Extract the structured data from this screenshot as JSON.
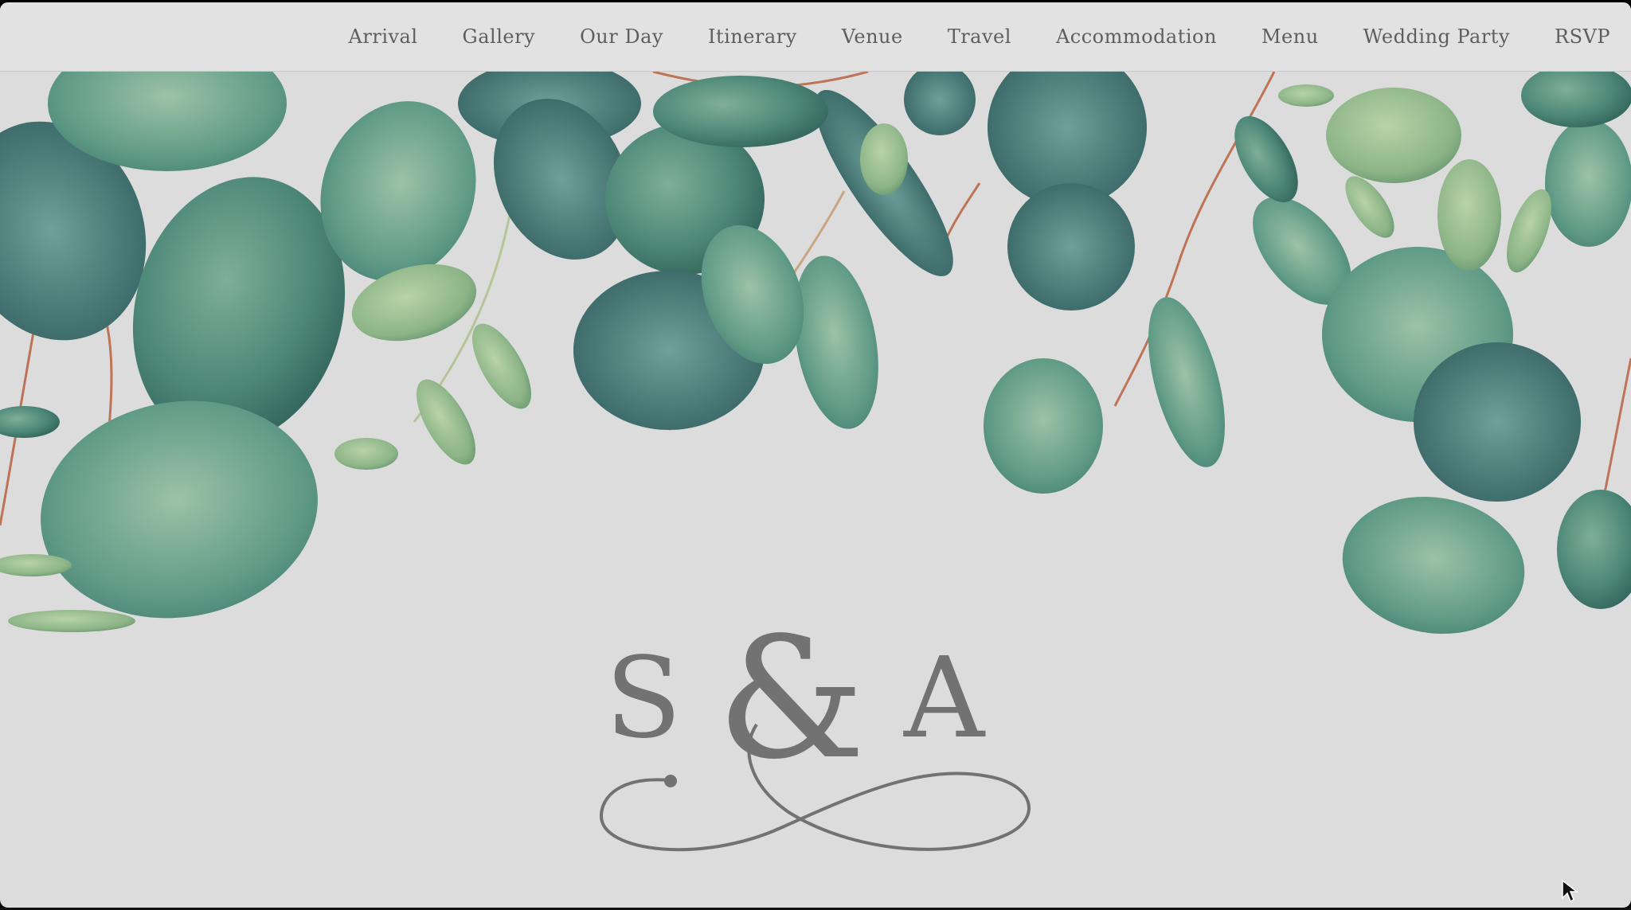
{
  "nav": {
    "items": [
      {
        "label": "Arrival"
      },
      {
        "label": "Gallery"
      },
      {
        "label": "Our Day"
      },
      {
        "label": "Itinerary"
      },
      {
        "label": "Venue"
      },
      {
        "label": "Travel"
      },
      {
        "label": "Accommodation"
      },
      {
        "label": "Menu"
      },
      {
        "label": "Wedding Party"
      },
      {
        "label": "RSVP"
      }
    ]
  },
  "hero": {
    "monogram": {
      "first_initial": "S",
      "ampersand": "&",
      "second_initial": "A"
    },
    "background_color": "#dcdcdc",
    "foliage_colors": [
      "#3f7a6e",
      "#5f9a86",
      "#7aa68c",
      "#9bbf8e",
      "#2f5e55",
      "#b85a3e"
    ]
  },
  "icons": {
    "cursor": "arrow-cursor-icon",
    "decoration": "eucalyptus-leaves-icon",
    "flourish": "infinity-flourish-icon"
  }
}
